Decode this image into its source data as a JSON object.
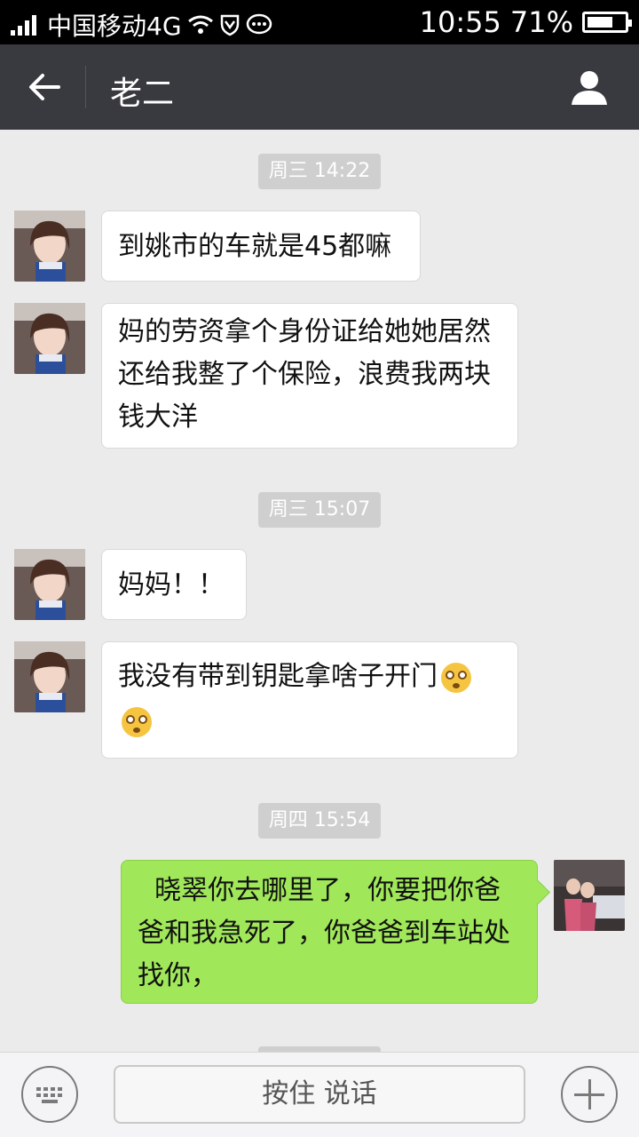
{
  "status_bar": {
    "carrier": "中国移动4G",
    "time": "10:55",
    "battery": "71%",
    "battery_level": 0.71
  },
  "header": {
    "title": "老二"
  },
  "messages": [
    {
      "type": "time",
      "text": "周三 14:22"
    },
    {
      "type": "msg",
      "side": "left",
      "text": "到姚市的车就是45都嘛"
    },
    {
      "type": "msg",
      "side": "left",
      "text": "妈的劳资拿个身份证给她她居然还给我整了个保险，浪费我两块钱大洋"
    },
    {
      "type": "time",
      "text": "周三 15:07"
    },
    {
      "type": "msg",
      "side": "left",
      "text": "妈妈！！"
    },
    {
      "type": "msg",
      "side": "left",
      "text": "我没有带到钥匙拿啥子开门"
    },
    {
      "type": "time",
      "text": "周四 15:54"
    },
    {
      "type": "msg",
      "side": "right",
      "text": "  晓翠你去哪里了，你要把你爸爸和我急死了，你爸爸到车站处找你，"
    }
  ],
  "input_bar": {
    "hold_to_talk": "按住 说话"
  },
  "colors": {
    "title_bg": "#393a3f",
    "chat_bg": "#ebebeb",
    "my_bubble": "#a0e75a"
  }
}
